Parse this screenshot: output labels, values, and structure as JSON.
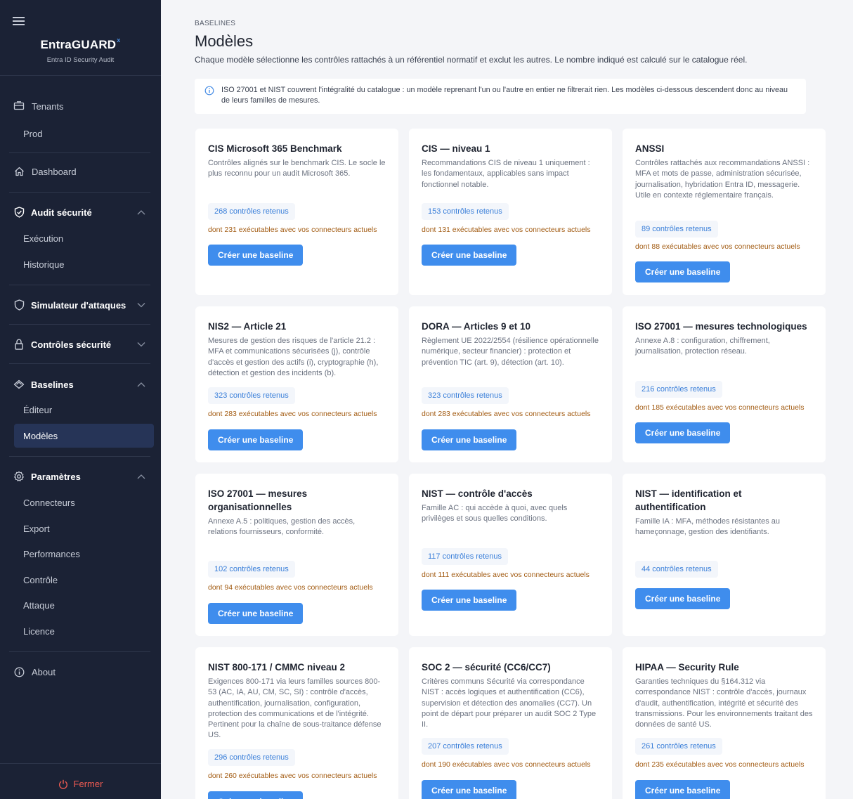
{
  "sidebar": {
    "brand": "EntraGUARD",
    "brand_sup": "x",
    "brand_sub": "Entra ID Security Audit",
    "tenants": "Tenants",
    "prod": "Prod",
    "dashboard": "Dashboard",
    "audit": "Audit sécurité",
    "execution": "Exécution",
    "historique": "Historique",
    "simulateur": "Simulateur d'attaques",
    "controles": "Contrôles sécurité",
    "baselines": "Baselines",
    "editeur": "Éditeur",
    "modeles": "Modèles",
    "parametres": "Paramètres",
    "connecteurs": "Connecteurs",
    "export": "Export",
    "performances": "Performances",
    "controle": "Contrôle",
    "attaque": "Attaque",
    "licence": "Licence",
    "about": "About",
    "close": "Fermer"
  },
  "header": {
    "breadcrumb": "BASELINES",
    "title": "Modèles",
    "subtitle": "Chaque modèle sélectionne les contrôles rattachés à un référentiel normatif et exclut les autres. Le nombre indiqué est calculé sur le catalogue réel."
  },
  "info": "ISO 27001 et NIST couvrent l'intégralité du catalogue : un modèle reprenant l'un ou l'autre en entier ne filtrerait rien. Les modèles ci-dessous descendent donc au niveau de leurs familles de mesures.",
  "cta_label": "Créer une baseline",
  "cards": [
    {
      "title": "CIS Microsoft 365 Benchmark",
      "desc": "Contrôles alignés sur le benchmark CIS. Le socle le plus reconnu pour un audit Microsoft 365.",
      "count": "268 contrôles retenus",
      "exec": "dont 231 exécutables avec vos connecteurs actuels"
    },
    {
      "title": "CIS — niveau 1",
      "desc": "Recommandations CIS de niveau 1 uniquement : les fondamentaux, applicables sans impact fonctionnel notable.",
      "count": "153 contrôles retenus",
      "exec": "dont 131 exécutables avec vos connecteurs actuels"
    },
    {
      "title": "ANSSI",
      "desc": "Contrôles rattachés aux recommandations ANSSI : MFA et mots de passe, administration sécurisée, journalisation, hybridation Entra ID, messagerie. Utile en contexte réglementaire français.",
      "count": "89 contrôles retenus",
      "exec": "dont 88 exécutables avec vos connecteurs actuels"
    },
    {
      "title": "NIS2 — Article 21",
      "desc": "Mesures de gestion des risques de l'article 21.2 : MFA et communications sécurisées (j), contrôle d'accès et gestion des actifs (i), cryptographie (h), détection et gestion des incidents (b).",
      "count": "323 contrôles retenus",
      "exec": "dont 283 exécutables avec vos connecteurs actuels"
    },
    {
      "title": "DORA — Articles 9 et 10",
      "desc": "Règlement UE 2022/2554 (résilience opérationnelle numérique, secteur financier) : protection et prévention TIC (art. 9), détection (art. 10).",
      "count": "323 contrôles retenus",
      "exec": "dont 283 exécutables avec vos connecteurs actuels"
    },
    {
      "title": "ISO 27001 — mesures technologiques",
      "desc": "Annexe A.8 : configuration, chiffrement, journalisation, protection réseau.",
      "count": "216 contrôles retenus",
      "exec": "dont 185 exécutables avec vos connecteurs actuels"
    },
    {
      "title": "ISO 27001 — mesures organisationnelles",
      "desc": "Annexe A.5 : politiques, gestion des accès, relations fournisseurs, conformité.",
      "count": "102 contrôles retenus",
      "exec": "dont 94 exécutables avec vos connecteurs actuels"
    },
    {
      "title": "NIST — contrôle d'accès",
      "desc": "Famille AC : qui accède à quoi, avec quels privilèges et sous quelles conditions.",
      "count": "117 contrôles retenus",
      "exec": "dont 111 exécutables avec vos connecteurs actuels"
    },
    {
      "title": "NIST — identification et authentification",
      "desc": "Famille IA : MFA, méthodes résistantes au hameçonnage, gestion des identifiants.",
      "count": "44 contrôles retenus",
      "exec": ""
    },
    {
      "title": "NIST 800-171 / CMMC niveau 2",
      "desc": "Exigences 800-171 via leurs familles sources 800-53 (AC, IA, AU, CM, SC, SI) : contrôle d'accès, authentification, journalisation, configuration, protection des communications et de l'intégrité. Pertinent pour la chaîne de sous-traitance défense US.",
      "count": "296 contrôles retenus",
      "exec": "dont 260 exécutables avec vos connecteurs actuels"
    },
    {
      "title": "SOC 2 — sécurité (CC6/CC7)",
      "desc": "Critères communs Sécurité via correspondance NIST : accès logiques et authentification (CC6), supervision et détection des anomalies (CC7). Un point de départ pour préparer un audit SOC 2 Type II.",
      "count": "207 contrôles retenus",
      "exec": "dont 190 exécutables avec vos connecteurs actuels"
    },
    {
      "title": "HIPAA — Security Rule",
      "desc": "Garanties techniques du §164.312 via correspondance NIST : contrôle d'accès, journaux d'audit, authentification, intégrité et sécurité des transmissions. Pour les environnements traitant des données de santé US.",
      "count": "261 contrôles retenus",
      "exec": "dont 235 exécutables avec vos connecteurs actuels"
    }
  ]
}
